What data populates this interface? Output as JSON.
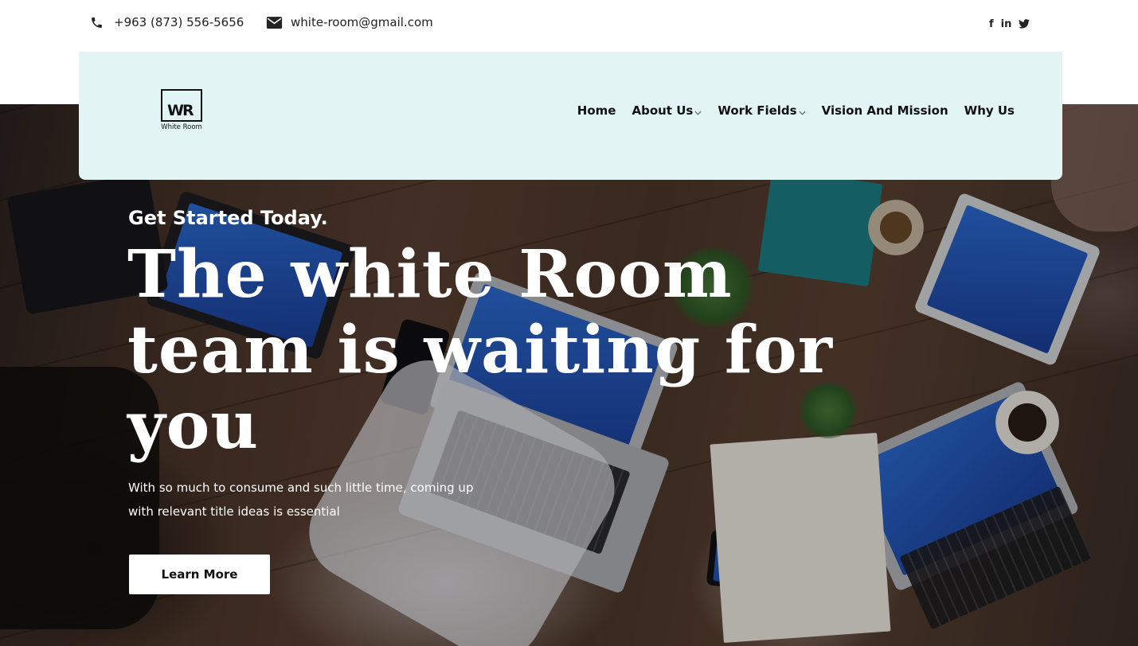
{
  "topbar": {
    "phone": "+963 (873) 556-5656",
    "email": "white-room@gmail.com",
    "social": [
      {
        "icon": "facebook-icon",
        "glyph": "f"
      },
      {
        "icon": "linkedin-icon",
        "glyph": "in"
      },
      {
        "icon": "twitter-icon",
        "glyph": "t"
      }
    ]
  },
  "logo": {
    "mark": "WR",
    "text": "White Room"
  },
  "nav": {
    "items": [
      {
        "label": "Home",
        "has_dropdown": false
      },
      {
        "label": "About Us",
        "has_dropdown": true
      },
      {
        "label": "Work Fields",
        "has_dropdown": true
      },
      {
        "label": "Vision And Mission",
        "has_dropdown": false
      },
      {
        "label": "Why Us",
        "has_dropdown": false
      }
    ]
  },
  "hero": {
    "eyebrow": "Get Started Today.",
    "headline": "The white Room team is waiting for you",
    "subtext": "With so much to consume and such little time, coming up with relevant title ideas is essential",
    "cta_label": "Learn More"
  },
  "colors": {
    "nav_background": "#e2f5f4",
    "text_dark": "#111111",
    "hero_text": "#ffffff",
    "button_background": "#ffffff"
  }
}
